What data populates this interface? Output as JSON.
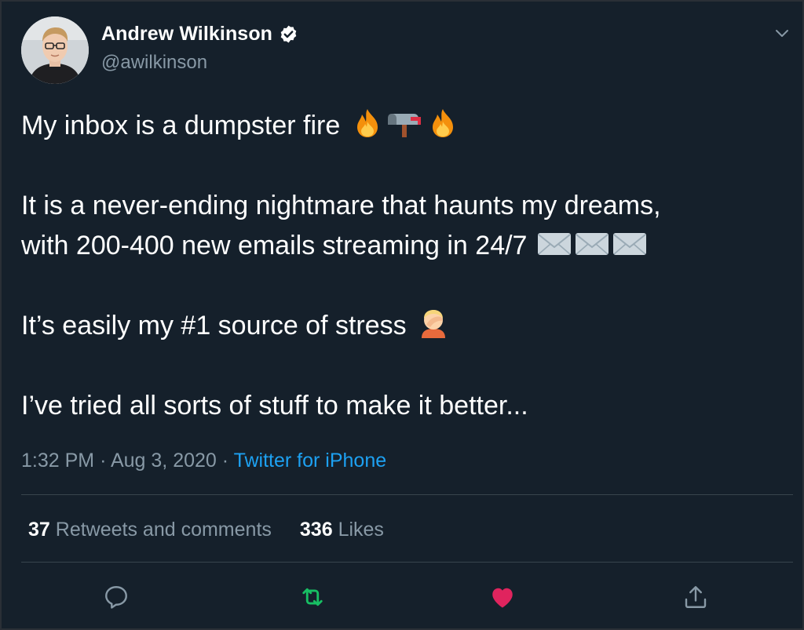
{
  "author": {
    "display_name": "Andrew Wilkinson",
    "handle": "@awilkinson",
    "verified": true
  },
  "tweet": {
    "paragraphs": [
      {
        "text": "My inbox is a dumpster fire ",
        "emojis": [
          "fire-emoji",
          "mailbox-emoji",
          "fire-emoji"
        ]
      },
      {
        "text": "It is a never-ending nightmare that haunts my dreams,",
        "emojis": []
      },
      {
        "text": "with 200-400 new emails streaming in 24/7 ",
        "emojis": [
          "envelope-emoji",
          "envelope-emoji",
          "envelope-emoji"
        ]
      },
      {
        "text": "It’s easily my #1 source of stress ",
        "emojis": [
          "facepalm-emoji"
        ]
      },
      {
        "text": "I’ve tried all sorts of stuff to make it better...",
        "emojis": []
      }
    ],
    "time": "1:32 PM",
    "date": "Aug 3, 2020",
    "separator": "·",
    "source": "Twitter for iPhone"
  },
  "stats": {
    "retweets_count": "37",
    "retweets_label": "Retweets and comments",
    "likes_count": "336",
    "likes_label": "Likes"
  },
  "actions": {
    "reply_icon": "reply-icon",
    "retweet_icon": "retweet-icon",
    "like_icon": "heart-icon",
    "share_icon": "share-icon"
  },
  "colors": {
    "background": "#15202b",
    "text": "#ffffff",
    "secondary": "#8899a6",
    "link": "#1da1f2",
    "retweet": "#17bf63",
    "like": "#e0245e",
    "divider": "#38444d"
  }
}
